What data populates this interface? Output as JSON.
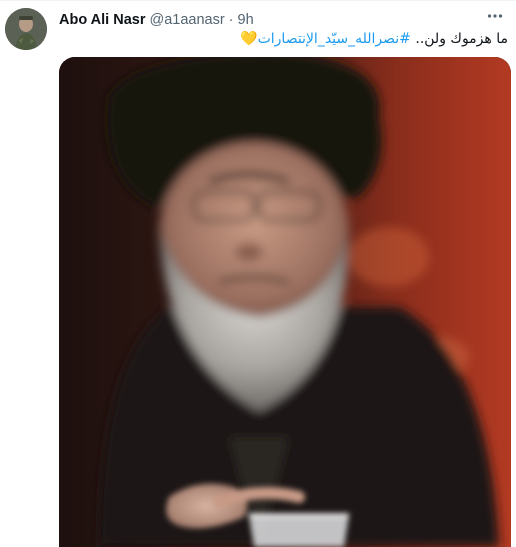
{
  "tweet": {
    "display_name": "Abo Ali Nasr",
    "handle": "@a1aanasr",
    "separator": "·",
    "time": "9h",
    "text_plain": "ما هزموك ولن.. ",
    "hashtag": "#نصرالله_سيّد_الإنتصارات",
    "emoji": "💛",
    "more_icon": "more-horizontal-icon",
    "media_alt": "photo"
  },
  "colors": {
    "accent": "#1d9bf0",
    "text_primary": "#0f1419",
    "text_secondary": "#536471",
    "heart": "#f4c542"
  }
}
